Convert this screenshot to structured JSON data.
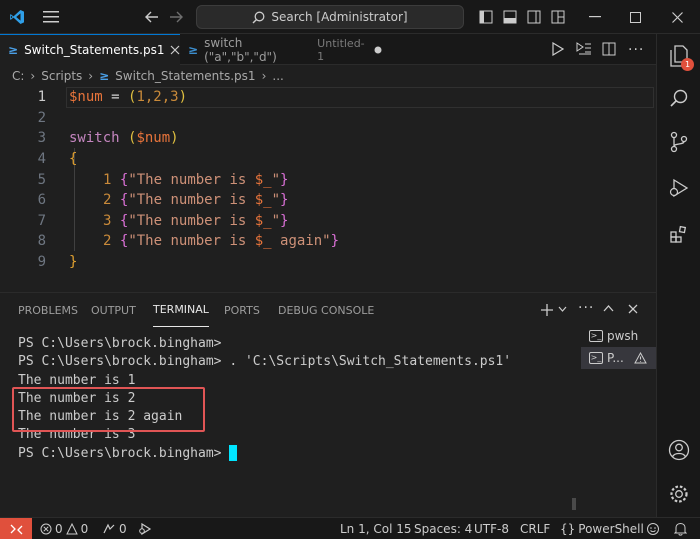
{
  "titlebar": {
    "search_label": "Search [Administrator]"
  },
  "tabs": [
    {
      "label": "Switch_Statements.ps1",
      "state": "active"
    },
    {
      "label": "switch (\"a\",\"b\",\"d\")",
      "sublabel": "Untitled-1",
      "state": "dirty"
    }
  ],
  "breadcrumb": {
    "drive": "C:",
    "folder": "Scripts",
    "file": "Switch_Statements.ps1",
    "more": "..."
  },
  "editor": {
    "line_numbers": [
      "1",
      "2",
      "3",
      "4",
      "5",
      "6",
      "7",
      "8",
      "9"
    ],
    "line1": {
      "var": "$num",
      "eq": " = ",
      "open": "(",
      "vals": "1,2,3",
      "close": ")"
    },
    "line3": {
      "kw": "switch",
      "sp": " ",
      "open": "(",
      "var": "$num",
      "close": ")"
    },
    "line4": {
      "brace": "{"
    },
    "cases": [
      {
        "num": "1",
        "open": "{",
        "q1": "\"The number is ",
        "var": "$_",
        "q2": "\"",
        "close": "}"
      },
      {
        "num": "2",
        "open": "{",
        "q1": "\"The number is ",
        "var": "$_",
        "q2": "\"",
        "close": "}"
      },
      {
        "num": "3",
        "open": "{",
        "q1": "\"The number is ",
        "var": "$_",
        "q2": "\"",
        "close": "}"
      },
      {
        "num": "2",
        "open": "{",
        "q1": "\"The number is ",
        "var": "$_",
        "q2": " again\"",
        "close": "}"
      }
    ],
    "line9": {
      "brace": "}"
    }
  },
  "panel": {
    "tabs": [
      "PROBLEMS",
      "OUTPUT",
      "TERMINAL",
      "PORTS",
      "DEBUG CONSOLE"
    ],
    "active_tab": "TERMINAL",
    "terminal_lines": [
      "PS C:\\Users\\brock.bingham>",
      "PS C:\\Users\\brock.bingham> . 'C:\\Scripts\\Switch_Statements.ps1'",
      "The number is 1",
      "The number is 2",
      "The number is 2 again",
      "The number is 3",
      "PS C:\\Users\\brock.bingham>"
    ],
    "terminals": [
      {
        "label": "pwsh",
        "active": false
      },
      {
        "label": "P...",
        "active": true
      }
    ]
  },
  "activity": {
    "badge": "1"
  },
  "status": {
    "errors": "0",
    "warnings": "0",
    "ports": "0",
    "position": "Ln 1, Col 15",
    "spaces": "Spaces: 4",
    "encoding": "UTF-8",
    "eol": "CRLF",
    "language": "PowerShell"
  },
  "colors": {
    "accent": "#0078d4",
    "highlight_box": "#e05555",
    "cursor": "#00e5ff",
    "remote": "#e0503c"
  }
}
